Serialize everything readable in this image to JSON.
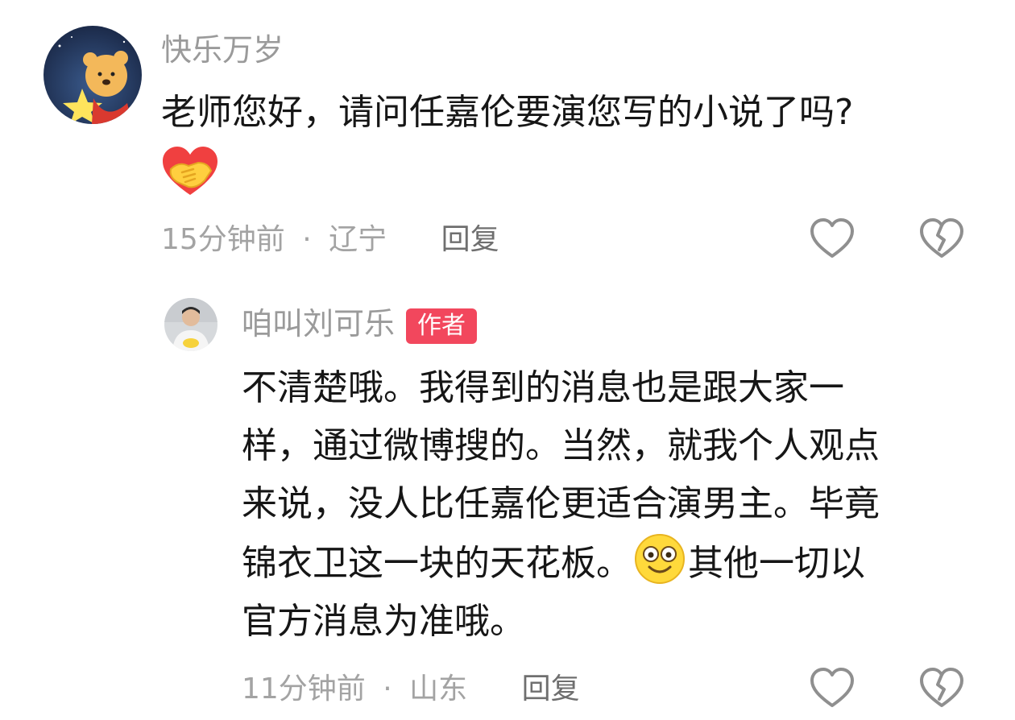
{
  "comment": {
    "username": "快乐万岁",
    "text": "老师您好，请问任嘉伦要演您写的小说了吗?",
    "emoji_icon": "handshake-heart-icon",
    "time": "15分钟前",
    "location": "辽宁",
    "separator": "·",
    "reply_label": "回复"
  },
  "reply": {
    "username": "咱叫刘可乐",
    "badge": "作者",
    "lines": [
      "不清楚哦。我得到的消息也是跟大家一",
      "样，通过微博搜的。当然，就我个人观点",
      "来说，没人比任嘉伦更适合演男主。毕竟"
    ],
    "line4_before": "锦衣卫这一块的天花板。",
    "line4_emoji_icon": "smiling-face-icon",
    "line4_after": "其他一切以",
    "line5": "官方消息为准哦。",
    "time": "11分钟前",
    "location": "山东",
    "separator": "·",
    "reply_label": "回复"
  },
  "icons": {
    "like": "heart-outline-icon",
    "dislike": "broken-heart-icon"
  },
  "colors": {
    "badge": "#f2475d",
    "username": "#9a9a9a",
    "meta": "#a3a3a3",
    "icon": "#8f8f8f"
  }
}
